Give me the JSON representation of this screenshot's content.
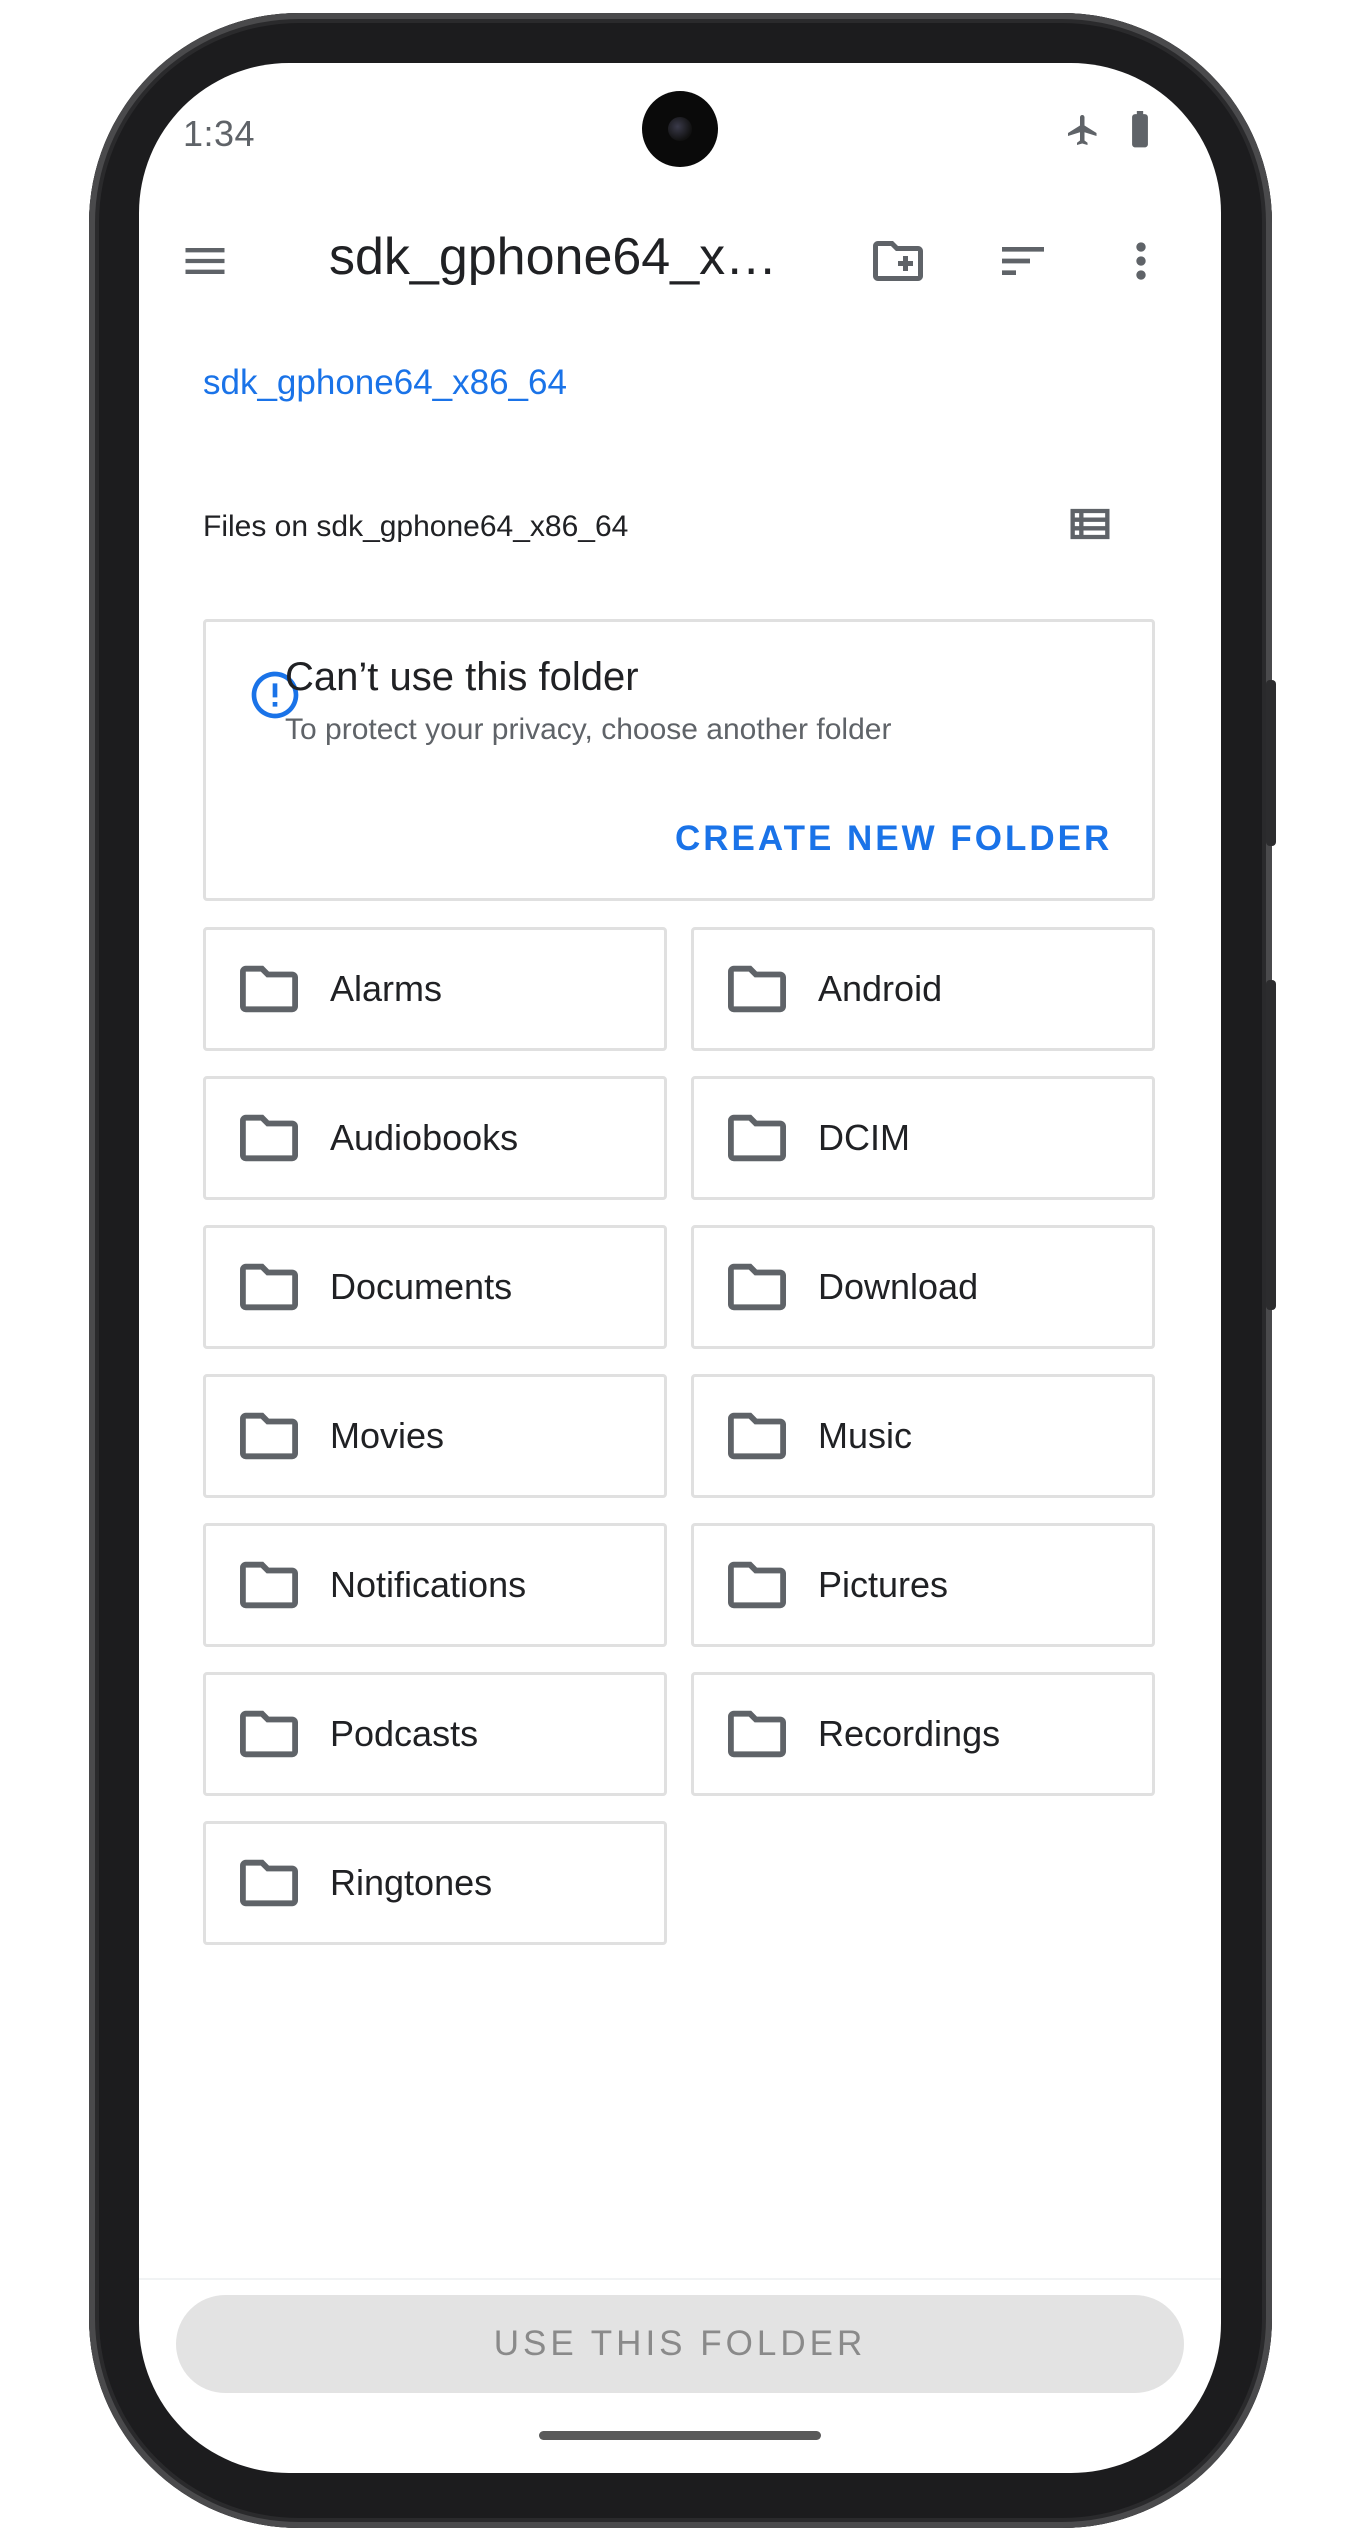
{
  "status_bar": {
    "time": "1:34",
    "icons": [
      "airplane-mode-icon",
      "battery-icon"
    ]
  },
  "toolbar": {
    "title": "sdk_gphone64_x8…",
    "icons": [
      "menu-icon",
      "new-folder-icon",
      "sort-icon",
      "more-vert-icon"
    ]
  },
  "breadcrumb": "sdk_gphone64_x86_64",
  "section_title": "Files on sdk_gphone64_x86_64",
  "notice_card": {
    "icon": "info-icon",
    "title": "Can’t use this folder",
    "subtitle": "To protect your privacy, choose another folder",
    "action": "CREATE NEW FOLDER"
  },
  "folders": [
    {
      "name": "Alarms"
    },
    {
      "name": "Android"
    },
    {
      "name": "Audiobooks"
    },
    {
      "name": "DCIM"
    },
    {
      "name": "Documents"
    },
    {
      "name": "Download"
    },
    {
      "name": "Movies"
    },
    {
      "name": "Music"
    },
    {
      "name": "Notifications"
    },
    {
      "name": "Pictures"
    },
    {
      "name": "Podcasts"
    },
    {
      "name": "Recordings"
    },
    {
      "name": "Ringtones"
    }
  ],
  "bottom_button": "USE THIS FOLDER",
  "colors": {
    "accent": "#1a73e8",
    "text_primary": "#202124",
    "text_secondary": "#5f6368",
    "border": "#e0e0e0",
    "disabled_button": "#e3e3e3"
  }
}
